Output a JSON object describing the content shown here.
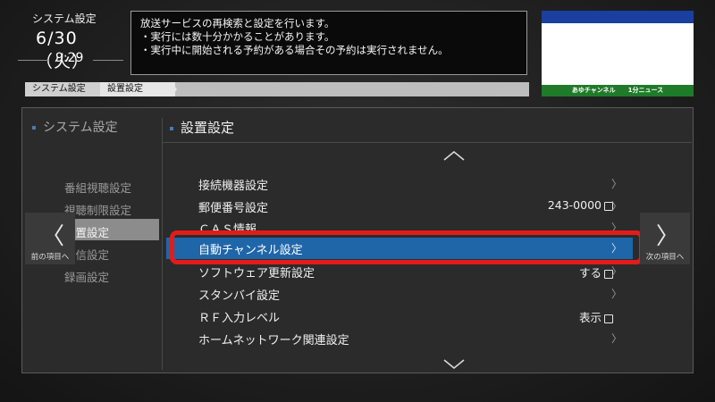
{
  "clock": {
    "title": "システム設定",
    "date": "6/30（火）",
    "time": "9:29"
  },
  "message": {
    "lines": [
      "放送サービスの再検索と設定を行います。",
      "・実行には数十分かかることがあります。",
      "・実行中に開始される予約がある場合その予約は実行されません。"
    ]
  },
  "preview": {
    "caption": "あゆチャンネル　　1分ニュース",
    "top_color": "#1a3f9f",
    "bottom_color": "#1f7a2a"
  },
  "breadcrumb": [
    "システム設定",
    "設置設定"
  ],
  "left_panel": {
    "title": "システム設定",
    "items": [
      "番組視聴設定",
      "視聴制限設定",
      "設置設定",
      "受信設定",
      "録画設定"
    ],
    "selected_index": 2
  },
  "right_panel": {
    "title": "設置設定",
    "items": [
      {
        "label": "接続機器設定",
        "value": "",
        "chevron": "〉"
      },
      {
        "label": "郵便番号設定",
        "value": "243-0000",
        "chevron": "〉"
      },
      {
        "label": "ＣＡＳ情報",
        "value": "",
        "chevron": "〉"
      },
      {
        "label": "自動チャンネル設定",
        "value": "",
        "chevron": "〉"
      },
      {
        "label": "ソフトウェア更新設定",
        "value": "する",
        "chevron": "〉"
      },
      {
        "label": "スタンバイ設定",
        "value": "",
        "chevron": "〉"
      },
      {
        "label": "ＲＦ入力レベル",
        "value": "表示",
        "chevron": ""
      },
      {
        "label": "ホームネットワーク関連設定",
        "value": "",
        "chevron": "〉"
      }
    ],
    "selected_index": 3
  },
  "nav": {
    "prev_label": "前の項目へ",
    "next_label": "次の項目へ"
  },
  "colors": {
    "selection": "#1f66a9",
    "highlight_ring": "#e41b1b"
  }
}
